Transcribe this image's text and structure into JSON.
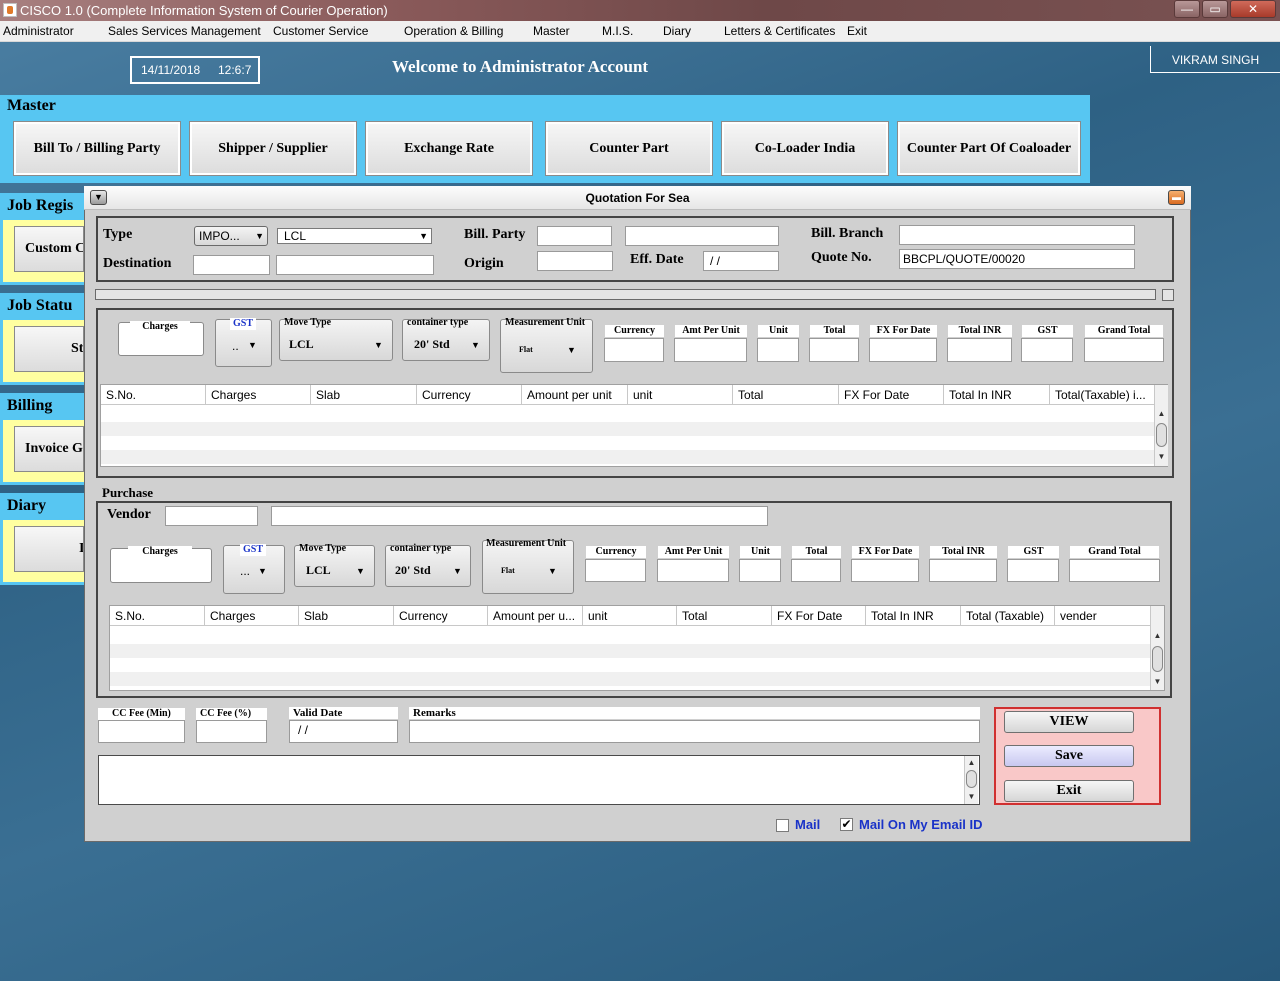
{
  "window": {
    "title": "CISCO 1.0 (Complete Information System of Courier Operation)",
    "minimize": "—",
    "restore": "▭",
    "close": "✕"
  },
  "menu": [
    "Administrator",
    "Sales Services Management",
    "Customer Service",
    "Operation & Billing",
    "Master",
    "M.I.S.",
    "Diary",
    "Letters & Certificates",
    "Exit"
  ],
  "header": {
    "date": "14/11/2018",
    "time": "12:6:7",
    "welcome": "Welcome to Administrator Account",
    "user": "VIKRAM SINGH"
  },
  "master": {
    "title": "Master",
    "buttons": [
      "Bill To / Billing Party",
      "Shipper / Supplier",
      "Exchange Rate",
      "Counter Part",
      "Co-Loader India",
      "Counter Part Of Coaloader"
    ]
  },
  "side": {
    "job_regis": {
      "title": "Job Regis",
      "button": "Custom Cl"
    },
    "job_status": {
      "title": "Job Statu",
      "button": "St"
    },
    "billing": {
      "title": "Billing",
      "button": "Invoice G"
    },
    "diary": {
      "title": "Diary",
      "button": "I"
    }
  },
  "dialog": {
    "title": "Quotation For Sea",
    "type_label": "Type",
    "type_value": "IMPO...",
    "mode_value": "LCL",
    "destination_label": "Destination",
    "bill_party_label": "Bill. Party",
    "origin_label": "Origin",
    "eff_date_label": "Eff. Date",
    "eff_date_value": "/ /",
    "bill_branch_label": "Bill. Branch",
    "quote_no_label": "Quote No.",
    "quote_no_value": "BBCPL/QUOTE/00020",
    "sale": {
      "charges_label": "Charges",
      "gst_label": "GST",
      "gst_value": "..",
      "move_type_label": "Move Type",
      "move_type_value": "LCL",
      "container_label": "container type",
      "container_value": "20' Std",
      "measure_label": "Measurement Unit",
      "measure_value": "Flat",
      "captions": [
        "Currency",
        "Amt Per Unit",
        "Unit",
        "Total",
        "FX For Date",
        "Total INR",
        "GST",
        "Grand Total"
      ],
      "columns": [
        "S.No.",
        "Charges",
        "Slab",
        "Currency",
        "Amount per unit",
        "unit",
        "Total",
        "FX For Date",
        "Total In INR",
        "Total(Taxable) i..."
      ]
    },
    "purchase": {
      "title": "Purchase",
      "vendor_label": "Vendor",
      "charges_label": "Charges",
      "gst_label": "GST",
      "gst_value": "...",
      "move_type_label": "Move Type",
      "move_type_value": "LCL",
      "container_label": "container type",
      "container_value": "20' Std",
      "measure_label": "Measurement Unit",
      "measure_value": "Flat",
      "captions": [
        "Currency",
        "Amt Per Unit",
        "Unit",
        "Total",
        "FX For Date",
        "Total INR",
        "GST",
        "Grand Total"
      ],
      "columns": [
        "S.No.",
        "Charges",
        "Slab",
        "Currency",
        "Amount per u...",
        "unit",
        "Total",
        "FX For Date",
        "Total In INR",
        "Total (Taxable)",
        "vender"
      ]
    },
    "cc_fee_min_label": "CC Fee (Min)",
    "cc_fee_pct_label": "CC Fee (%)",
    "valid_date_label": "Valid Date",
    "valid_date_value": "/ /",
    "remarks_label": "Remarks",
    "buttons": {
      "view": "VIEW",
      "save": "Save",
      "exit": "Exit"
    },
    "mail_label": "Mail",
    "mail_checked": false,
    "mail_my_label": "Mail On My Email ID",
    "mail_my_checked": true
  },
  "colors": {
    "master_bg": "#57c6f2",
    "side_inner": "#ffffa0",
    "action_panel": "#f9c8c8",
    "action_border": "#d03030",
    "link_blue": "#1a33c8"
  }
}
